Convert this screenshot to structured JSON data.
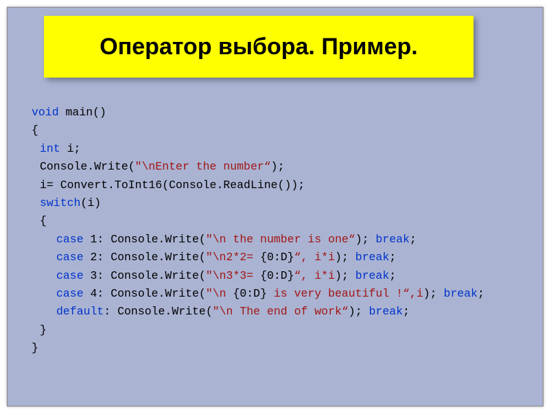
{
  "title": "Оператор выбора. Пример.",
  "code": {
    "void": "void",
    "main_sig": " main()",
    "lbrace": "{",
    "int": "int",
    "i_decl": " i;",
    "console_write": " Console.Write(",
    "q": "\"",
    "str_enter": "\\nEnter the number“",
    "close_call_semi": ");",
    "convert_line": " i= Convert.ToInt16(Console.ReadLine());",
    "switch": "switch",
    "switch_arg": "(i)",
    "case": "case",
    "case1_pre": " 1: Console.Write(",
    "case1_str": "\\n the number is one“",
    "case1_post": "); ",
    "break": "break",
    "semi": ";",
    "case2_pre": " 2: Console.Write(",
    "case2_str1": "\\n2*2= ",
    "case2_bracket": "{0:D}",
    "case2_str2": "“, i*i",
    "case2_post": "); ",
    "case3_pre": " 3: Console.Write(",
    "case3_str1": "\\n3*3= ",
    "case3_str2": "“, i*i",
    "case3_post": "); ",
    "case4_pre": " 4: Console.Write(",
    "case4_str1": "\\n ",
    "case4_str2": " is very beautiful !“,i",
    "case4_post": "); ",
    "default": "default",
    "default_pre": ": Console.Write(",
    "default_str": "\\n The end of work“",
    "default_post": "); ",
    "rbrace": "}"
  }
}
